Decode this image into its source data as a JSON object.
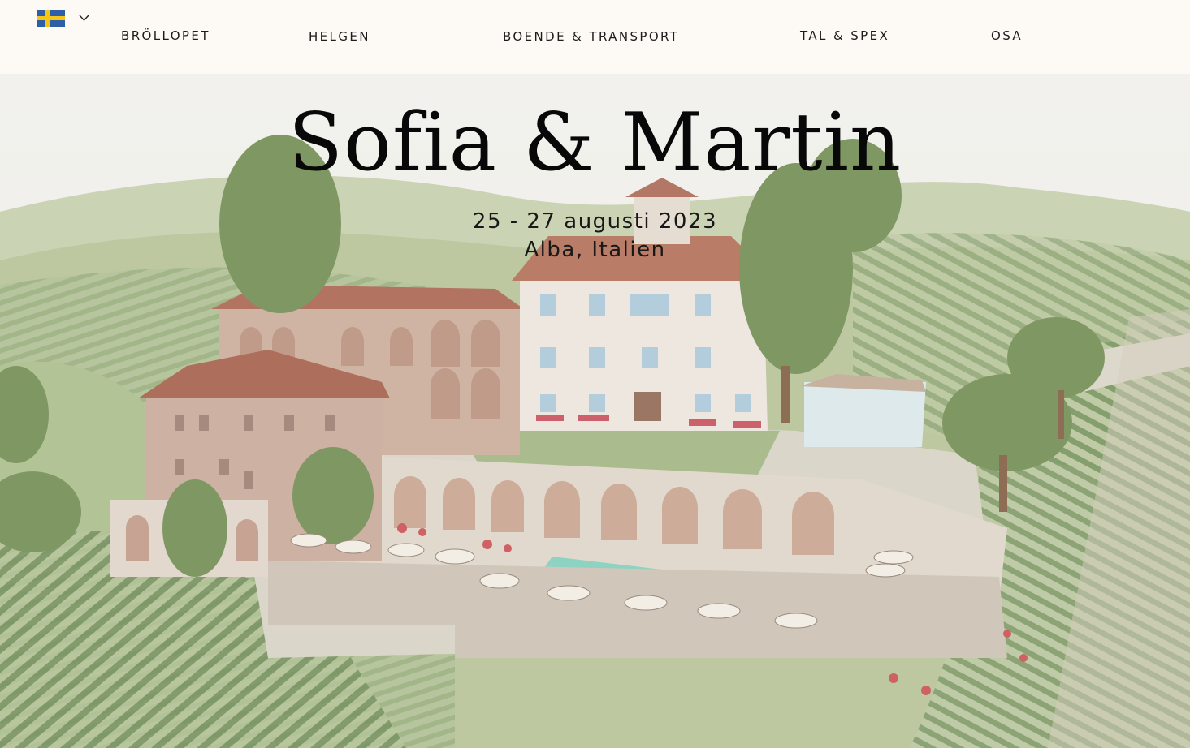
{
  "header": {
    "language": {
      "flag_icon": "sweden-flag-icon",
      "dropdown_icon": "chevron-down-icon"
    },
    "nav": [
      {
        "id": "brollopet",
        "label": "BRÖLLOPET"
      },
      {
        "id": "helgen",
        "label": "HELGEN"
      },
      {
        "id": "boende",
        "label": "BOENDE & TRANSPORT"
      },
      {
        "id": "tal",
        "label": "TAL & SPEX"
      },
      {
        "id": "osa",
        "label": "OSA"
      }
    ]
  },
  "hero": {
    "title": "Sofia & Martin",
    "dates": "25 - 27 augusti 2023",
    "location": "Alba, Italien",
    "image": "watercolor-villa-painting"
  },
  "colors": {
    "header_bg": "#fdf9f4",
    "text": "#1c1c1c",
    "flag_blue": "#2f5ea8",
    "flag_yellow": "#f5c518"
  }
}
